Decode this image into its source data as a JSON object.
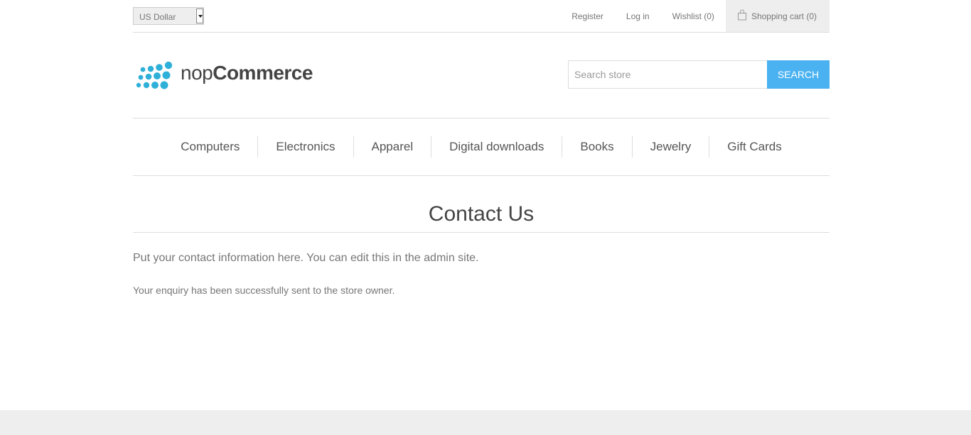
{
  "header": {
    "currency": {
      "selected": "US Dollar"
    },
    "links": {
      "register": "Register",
      "login": "Log in",
      "wishlist": "Wishlist (0)",
      "cart": "Shopping cart (0)"
    }
  },
  "logo": {
    "light": "nop",
    "bold": "Commerce"
  },
  "search": {
    "placeholder": "Search store",
    "button": "SEARCH"
  },
  "menu": {
    "items": [
      "Computers",
      "Electronics",
      "Apparel",
      "Digital downloads",
      "Books",
      "Jewelry",
      "Gift Cards"
    ]
  },
  "main": {
    "title": "Contact Us",
    "topic_text": "Put your contact information here. You can edit this in the admin site.",
    "result_text": "Your enquiry has been successfully sent to the store owner."
  },
  "colors": {
    "accent": "#4ab2f1",
    "logo_dots": "#2fb0d8",
    "footer_bg": "#eeeeee"
  }
}
